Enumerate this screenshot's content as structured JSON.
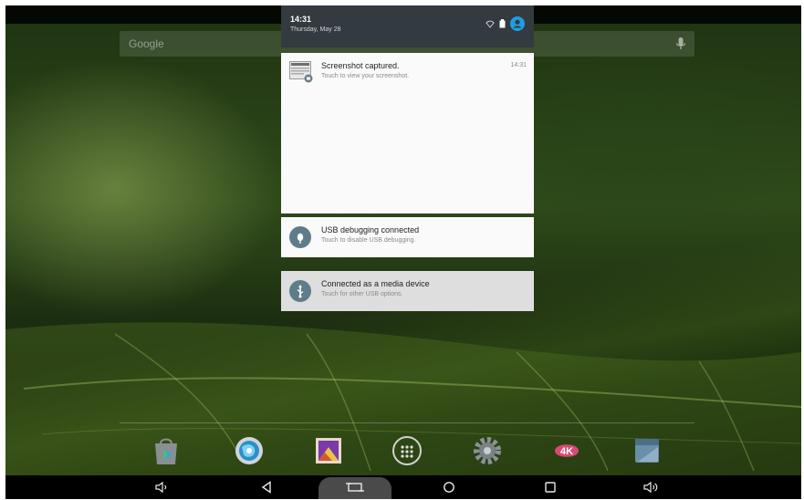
{
  "status_shade": {
    "time": "14:31",
    "date": "Thursday, May 28"
  },
  "search": {
    "logo": "Google"
  },
  "notifications": [
    {
      "title": "Screenshot captured.",
      "subtitle": "Touch to view your screenshot.",
      "time": "14:31",
      "icon": "screenshot-thumbnail-icon"
    },
    {
      "title": "USB debugging connected",
      "subtitle": "Touch to disable USB debugging.",
      "icon": "bug-icon"
    },
    {
      "title": "Connected as a media device",
      "subtitle": "Touch for other USB options.",
      "icon": "usb-icon"
    }
  ],
  "dock": [
    {
      "name": "Play Store",
      "icon": "play-store-icon"
    },
    {
      "name": "Browser",
      "icon": "browser-icon"
    },
    {
      "name": "Gallery",
      "icon": "gallery-icon"
    },
    {
      "name": "All Apps",
      "icon": "app-drawer-icon"
    },
    {
      "name": "Settings",
      "icon": "settings-icon"
    },
    {
      "name": "4K Player",
      "icon": "4k-player-icon",
      "label": "4K"
    },
    {
      "name": "Calendar",
      "icon": "calendar-icon"
    }
  ],
  "navbar": [
    {
      "icon": "volume-down-icon"
    },
    {
      "icon": "back-icon"
    },
    {
      "icon": "screenshot-icon"
    },
    {
      "icon": "home-icon"
    },
    {
      "icon": "recents-icon"
    },
    {
      "icon": "volume-up-icon"
    }
  ],
  "colors": {
    "shade_header": "#333a40",
    "notification_bg": "#fafafa",
    "icon_circle": "#5f7c8a",
    "account_blue": "#1e9fe0"
  }
}
